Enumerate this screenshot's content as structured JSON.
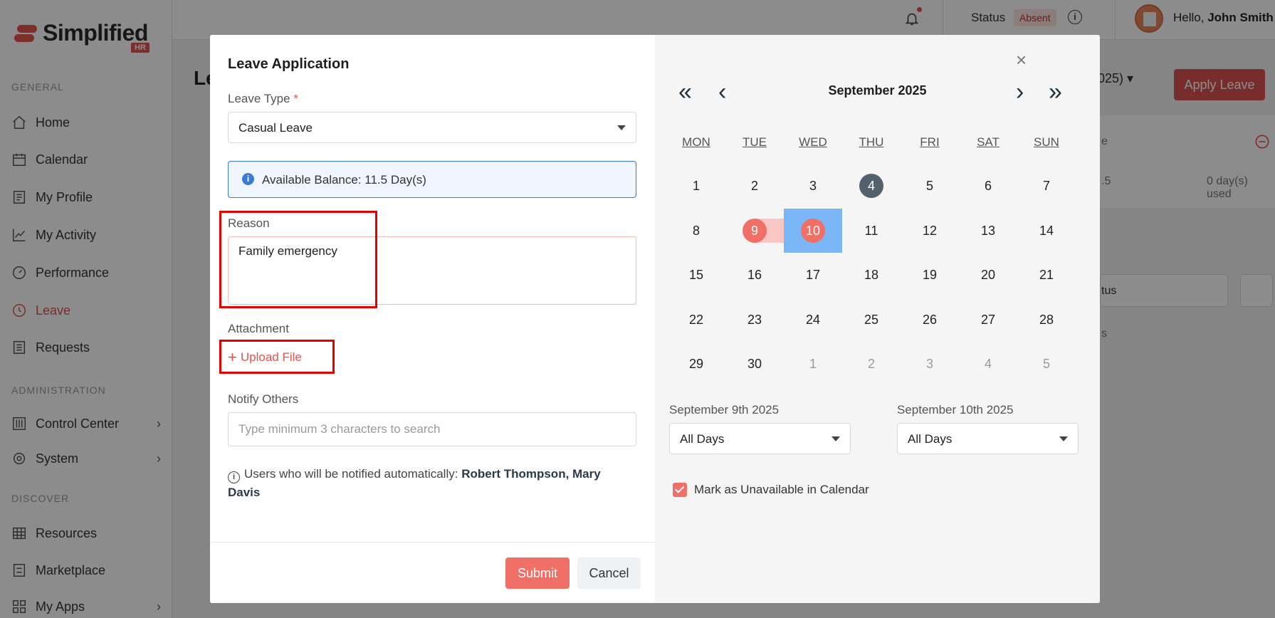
{
  "app": {
    "logo_text": "Simplified",
    "logo_badge": "HR",
    "sections": {
      "general": "GENERAL",
      "administration": "ADMINISTRATION",
      "discover": "DISCOVER"
    },
    "nav": [
      {
        "label": "Home",
        "icon": "home-icon"
      },
      {
        "label": "Calendar",
        "icon": "calendar-icon"
      },
      {
        "label": "My Profile",
        "icon": "profile-icon"
      },
      {
        "label": "My Activity",
        "icon": "activity-icon"
      },
      {
        "label": "Performance",
        "icon": "gauge-icon"
      },
      {
        "label": "Leave",
        "icon": "clock-icon",
        "active": true
      },
      {
        "label": "Requests",
        "icon": "requests-icon"
      },
      {
        "label": "Control Center",
        "icon": "sliders-icon"
      },
      {
        "label": "System",
        "icon": "gear-icon"
      },
      {
        "label": "Resources",
        "icon": "table-icon"
      },
      {
        "label": "Marketplace",
        "icon": "store-icon"
      },
      {
        "label": "My Apps",
        "icon": "grid-icon"
      }
    ],
    "topbar": {
      "status_label": "Status",
      "status_value": "Absent",
      "greeting": "Hello,",
      "user_name": "John Smith"
    },
    "page": {
      "title_partial": "Le",
      "year_select_partial": "2025)",
      "apply_button": "Apply Leave",
      "bg_text_1": "e",
      "bg_text_2": ".5",
      "bg_text_3": "0 day(s) used",
      "bg_text_4": "tus",
      "bg_text_5": "s"
    },
    "accent_color": "#d9534f"
  },
  "modal": {
    "title": "Leave Application",
    "leave_type_label": "Leave Type",
    "required_mark": "*",
    "leave_type_value": "Casual Leave",
    "balance_text": "Available Balance: 11.5 Day(s)",
    "reason_label": "Reason",
    "reason_value": "Family emergency",
    "attachment_label": "Attachment",
    "upload_plus": "+",
    "upload_label": "Upload File",
    "notify_label": "Notify Others",
    "notify_placeholder": "Type minimum 3 characters to search",
    "notice_prefix": "Users who will be notified automatically:",
    "notice_names": "Robert Thompson, Mary Davis",
    "submit_label": "Submit",
    "cancel_label": "Cancel",
    "close_symbol": "×"
  },
  "calendar": {
    "month_label": "September 2025",
    "prev_year": "«",
    "prev_month": "‹",
    "next_month": "›",
    "next_year": "»",
    "weekdays": [
      "MON",
      "TUE",
      "WED",
      "THU",
      "FRI",
      "SAT",
      "SUN"
    ],
    "weeks": [
      [
        "1",
        "2",
        "3",
        "4",
        "5",
        "6",
        "7"
      ],
      [
        "8",
        "9",
        "10",
        "11",
        "12",
        "13",
        "14"
      ],
      [
        "15",
        "16",
        "17",
        "18",
        "19",
        "20",
        "21"
      ],
      [
        "22",
        "23",
        "24",
        "25",
        "26",
        "27",
        "28"
      ],
      [
        "29",
        "30",
        "1",
        "2",
        "3",
        "4",
        "5"
      ]
    ],
    "today": "4",
    "range_start": "9",
    "range_end": "10",
    "start_date_label": "September 9th 2025",
    "end_date_label": "September 10th 2025",
    "start_day_option": "All Days",
    "end_day_option": "All Days",
    "mark_unavailable_label": "Mark as Unavailable in Calendar",
    "mark_unavailable_checked": true
  }
}
